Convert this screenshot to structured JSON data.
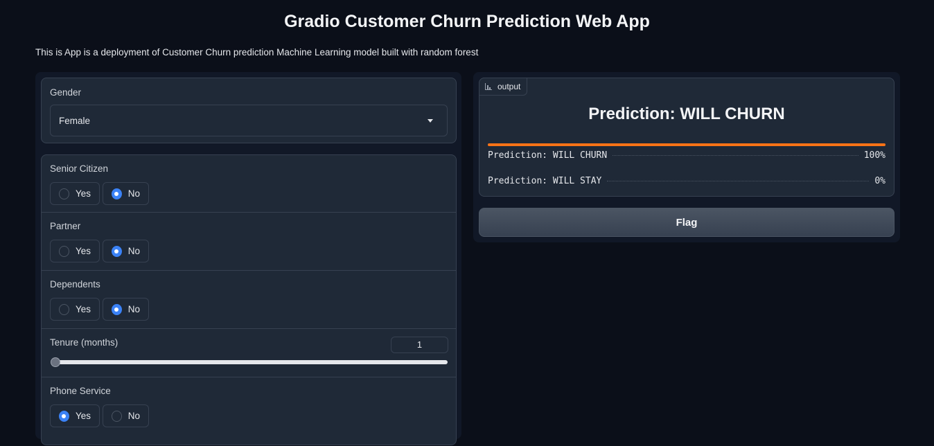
{
  "app": {
    "title": "Gradio Customer Churn Prediction Web App",
    "description": "This is App is a deployment of Customer Churn prediction Machine Learning model built with random forest"
  },
  "inputs": {
    "gender": {
      "label": "Gender",
      "value": "Female"
    },
    "senior_citizen": {
      "label": "Senior Citizen",
      "options": [
        "Yes",
        "No"
      ],
      "selected": "No"
    },
    "partner": {
      "label": "Partner",
      "options": [
        "Yes",
        "No"
      ],
      "selected": "No"
    },
    "dependents": {
      "label": "Dependents",
      "options": [
        "Yes",
        "No"
      ],
      "selected": "No"
    },
    "tenure": {
      "label": "Tenure (months)",
      "value": "1",
      "slider_fraction": 0
    },
    "phone_service": {
      "label": "Phone Service",
      "options": [
        "Yes",
        "No"
      ],
      "selected": "Yes"
    }
  },
  "output": {
    "tag": "output",
    "headline": "Prediction: WILL CHURN",
    "confidence_fraction": 1.0,
    "confidences": [
      {
        "label": "Prediction: WILL CHURN",
        "value": "100%"
      },
      {
        "label": "Prediction: WILL STAY",
        "value": "0%"
      }
    ],
    "accent_color": "#f97316"
  },
  "actions": {
    "flag_label": "Flag"
  }
}
